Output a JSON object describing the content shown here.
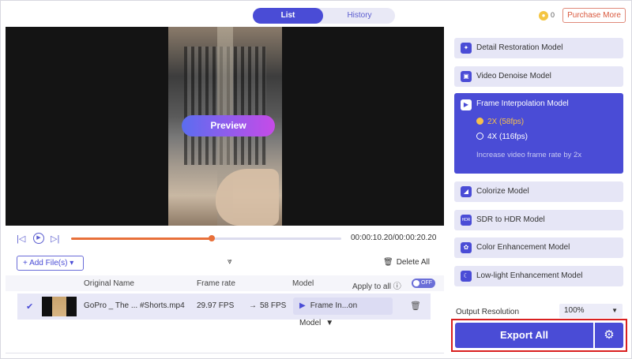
{
  "tabs": {
    "list": "List",
    "history": "History"
  },
  "header": {
    "coin_count": "0",
    "purchase_label": "Purchase More"
  },
  "preview": {
    "button_label": "Preview"
  },
  "playback": {
    "time": "00:00:10.20/00:00:20.20",
    "progress": 0.52
  },
  "files": {
    "add_label": "Add File(s)",
    "delete_all_label": "Delete All",
    "columns": {
      "name": "Original Name",
      "frame_rate": "Frame rate",
      "model": "Model",
      "apply_all": "Apply to all"
    },
    "apply_toggle": "OFF",
    "rows": [
      {
        "name": "GoPro _ The ... #Shorts.mp4",
        "fps_from": "29.97 FPS",
        "arrow": "→",
        "fps_to": "58 FPS",
        "model": "Frame In...on Model"
      }
    ]
  },
  "models": [
    {
      "label": "Detail Restoration Model",
      "icon": "detail-restoration-icon"
    },
    {
      "label": "Video Denoise Model",
      "icon": "video-denoise-icon"
    },
    {
      "label": "Frame Interpolation Model",
      "icon": "frame-interpolation-icon",
      "active": true,
      "options": [
        "2X (58fps)",
        "4X (116fps)"
      ],
      "selected": "2X (58fps)",
      "note": "Increase video frame rate by 2x"
    },
    {
      "label": "Colorize Model",
      "icon": "colorize-icon"
    },
    {
      "label": "SDR to HDR Model",
      "icon": "hdr-icon",
      "icon_text": "HDR"
    },
    {
      "label": "Color Enhancement Model",
      "icon": "palette-icon"
    },
    {
      "label": "Low-light Enhancement Model",
      "icon": "moon-icon"
    }
  ],
  "output": {
    "label": "Output Resolution",
    "value": "100%"
  },
  "export": {
    "label": "Export All"
  },
  "colors": {
    "accent": "#4a4cd6",
    "orange": "#e8703a",
    "highlight": "#d92020"
  }
}
